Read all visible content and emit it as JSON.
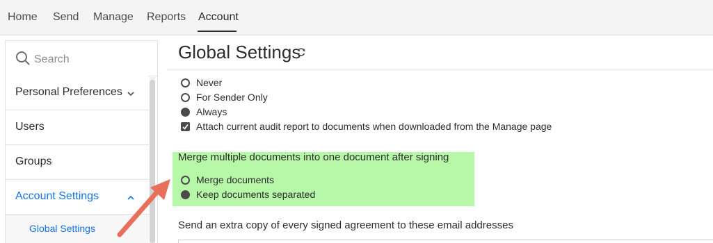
{
  "topnav": {
    "items": [
      {
        "label": "Home"
      },
      {
        "label": "Send"
      },
      {
        "label": "Manage"
      },
      {
        "label": "Reports"
      },
      {
        "label": "Account"
      }
    ],
    "active": "Account"
  },
  "sidebar": {
    "search": {
      "placeholder": "Search"
    },
    "items": [
      {
        "label": "Personal Preferences"
      },
      {
        "label": "Users"
      },
      {
        "label": "Groups"
      },
      {
        "label": "Account Settings"
      }
    ],
    "subitems": [
      {
        "label": "Global Settings"
      }
    ]
  },
  "main": {
    "title": "Global Settings",
    "audit_options": [
      {
        "label": "Never",
        "selected": false
      },
      {
        "label": "For Sender Only",
        "selected": false
      },
      {
        "label": "Always",
        "selected": true
      }
    ],
    "attach_audit_label": "Attach current audit report to documents when downloaded from the Manage page",
    "attach_audit_checked": true,
    "merge": {
      "title": "Merge multiple documents into one document after signing",
      "options": [
        {
          "label": "Merge documents",
          "selected": false
        },
        {
          "label": "Keep documents separated",
          "selected": true
        }
      ]
    },
    "extra_copy_title": "Send an extra copy of every signed agreement to these email addresses"
  },
  "colors": {
    "accent": "#1473e6",
    "highlight": "#b7f7a8",
    "arrow": "#e8705a"
  }
}
